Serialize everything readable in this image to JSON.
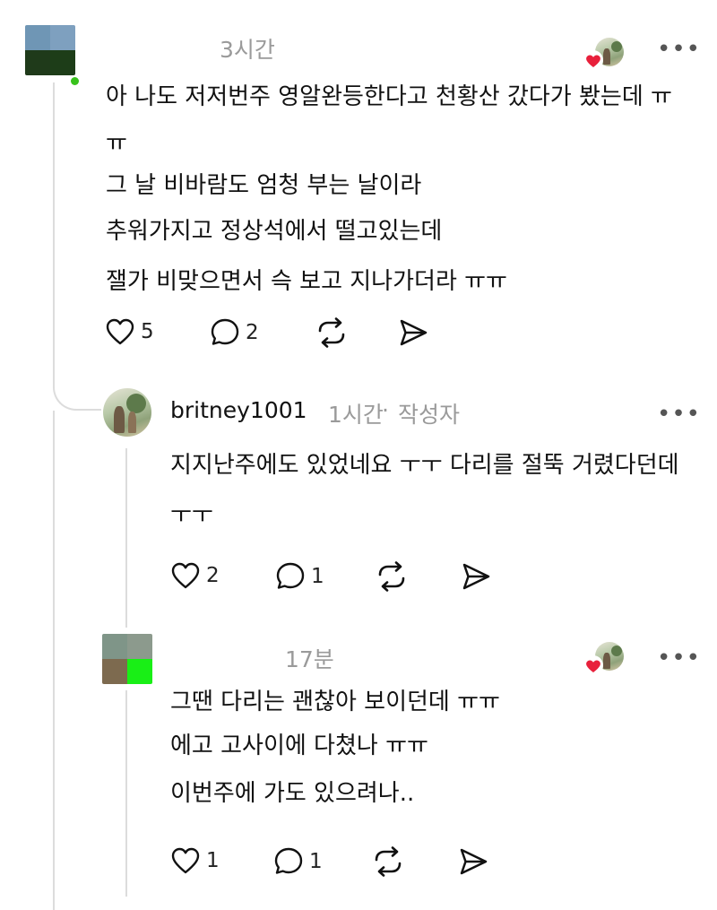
{
  "comments": [
    {
      "time": "3시간",
      "lines": [
        "아 나도 저저번주 영알완등한다고 천황산 갔다가 봤는데 ㅠ",
        "ㅠ",
        "그 날 비바람도 엄청 부는 날이라",
        "추워가지고 정상석에서 떨고있는데",
        "잴가 비맞으면서 슥 보고 지나가더라 ㅠㅠ"
      ],
      "likes": "5",
      "replies": "2",
      "more": "•••",
      "colors": {
        "avatar": [
          "#6f96b5",
          "#7ea0bf",
          "#1f3a1a",
          "#1d3d18"
        ],
        "dot": "#38c21c"
      }
    },
    {
      "username": "britney1001",
      "time": "1시간",
      "separator": "·",
      "author_badge": "작성자",
      "lines": [
        "지지난주에도 있었네요 ㅜㅜ 다리를 절뚝 거렸다던데",
        "ㅜㅜ"
      ],
      "likes": "2",
      "replies": "1",
      "more": "•••"
    },
    {
      "time": "17분",
      "lines": [
        "그땐 다리는 괜찮아 보이던데 ㅠㅠ",
        "에고 고사이에 다쳤나 ㅠㅠ",
        "이번주에 가도 있으려나.."
      ],
      "likes": "1",
      "replies": "1",
      "more": "•••",
      "colors": {
        "avatar": [
          "#7f9588",
          "#8c9a8d",
          "#7d6a4f",
          "#19ef16"
        ]
      }
    }
  ],
  "icons": [
    "heart-icon",
    "comment-icon",
    "repost-icon",
    "share-icon",
    "more-icon",
    "liked-heart-icon"
  ],
  "accent": {
    "heart": "#e8203b",
    "line": "#dcdcdc"
  }
}
